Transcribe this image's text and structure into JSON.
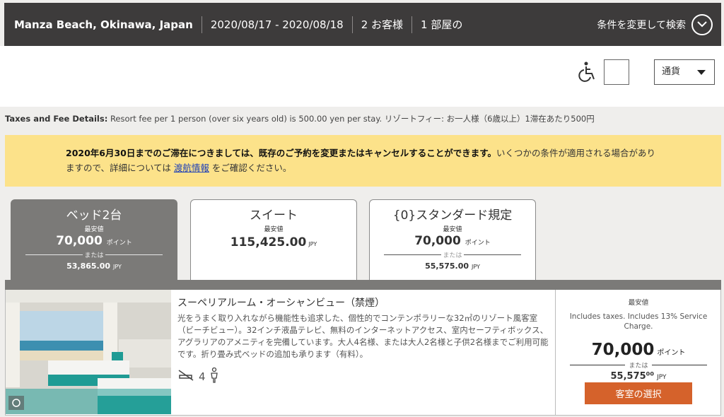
{
  "search": {
    "location": "Manza Beach, Okinawa, Japan",
    "dates": "2020/08/17 - 2020/08/18",
    "guests": "2 お客様",
    "rooms": "1 部屋の",
    "modify_label": "条件を変更して検索"
  },
  "tools": {
    "currency_label": "通貨"
  },
  "taxes": {
    "label": "Taxes and Fee Details:",
    "text": " Resort fee per 1 person (over six years old) is 500.00 yen per stay. リゾートフィー: お一人様（6歳以上）1滞在あたり500円"
  },
  "notice": {
    "bold": "2020年6月30日までのご滞在につきましては、既存のご予約を変更またはキャンセルすることができます。",
    "text": "いくつかの条件が適用される場合がありますので、詳細については ",
    "link": "渡航情報",
    "after": " をご確認ください。"
  },
  "tabs": [
    {
      "title": "ベッド2台",
      "lowest": "最安値",
      "points": "70,000",
      "points_unit": "ポイント",
      "or": "または",
      "cash": "53,865.00",
      "cash_unit": "JPY"
    },
    {
      "title": "スイート",
      "lowest": "最安値",
      "price": "115,425.00",
      "price_unit": "JPY"
    },
    {
      "title": "{0}スタンダード規定",
      "lowest": "最安値",
      "points": "70,000",
      "points_unit": "ポイント",
      "or": "または",
      "cash": "55,575.00",
      "cash_unit": "JPY"
    }
  ],
  "room": {
    "title": "スーペリアルーム・オーシャンビュー（禁煙）",
    "description": "光をうまく取り入れながら機能性も追求した、個性的でコンテンポラリーな32㎡のリゾート風客室（ビーチビュー）。32インチ液晶テレビ、無料のインターネットアクセス、室内セーフティボックス、アグラリアのアメニティを完備しています。大人4名様、または大人2名様と子供2名様までご利用可能です。折り畳み式ベッドの追加も承ります（有料）。",
    "occupancy": "4",
    "price": {
      "lowest": "最安値",
      "includes": "Includes taxes. Includes 13% Service Charge.",
      "points": "70,000",
      "points_unit": "ポイント",
      "or": "または",
      "cash": "55,575⁰⁰",
      "cash_unit": "JPY",
      "select_label": "客室の選択"
    }
  },
  "colors": {
    "header": "#3d3b3b",
    "notice": "#fce28a",
    "active_tab": "#7b7a78",
    "button": "#d5622b"
  }
}
